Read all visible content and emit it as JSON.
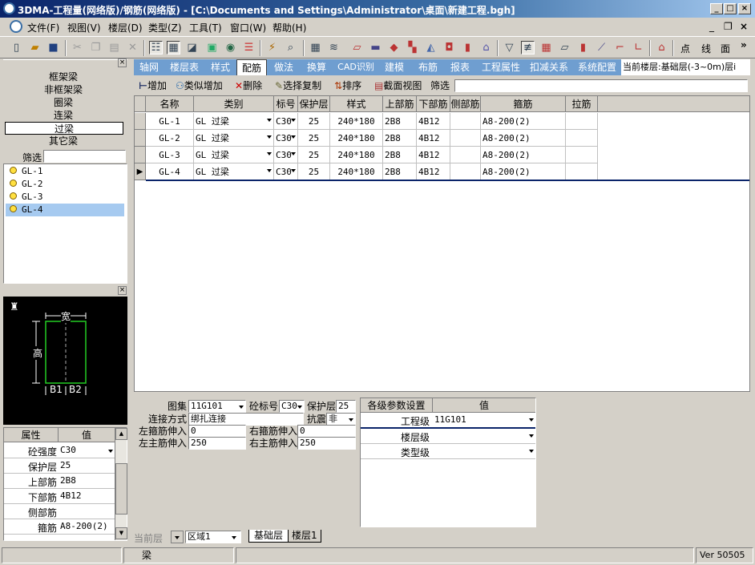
{
  "window": {
    "title": "3DMA-工程量(网络版)/钢筋(网络版) - [C:\\Documents and Settings\\Administrator\\桌面\\新建工程.bgh]",
    "min": "_",
    "restore": "□",
    "close": "×",
    "mdi_min": "_",
    "mdi_restore": "❐",
    "mdi_close": "×"
  },
  "menu": [
    "文件(F)",
    "视图(V)",
    "楼层(D)",
    "类型(Z)",
    "工具(T)",
    "窗口(W)",
    "帮助(H)"
  ],
  "toolbar": {
    "text_buttons": [
      "点",
      "线",
      "面"
    ],
    "more": "»"
  },
  "left": {
    "categories": [
      "框架梁",
      "非框架梁",
      "圈梁",
      "连梁",
      "过梁",
      "其它梁"
    ],
    "selected_category": "过梁",
    "filter_label": "筛选",
    "filter_value": "",
    "items": [
      "GL-1",
      "GL-2",
      "GL-3",
      "GL-4"
    ],
    "selected_item": "GL-4",
    "close": "×"
  },
  "diagram": {
    "width_label": "宽",
    "height_label": "高",
    "b1": "B1",
    "b2": "B2"
  },
  "properties": {
    "header_attr": "属性",
    "header_val": "值",
    "rows": [
      {
        "name": "砼强度",
        "value": "C30"
      },
      {
        "name": "保护层",
        "value": "25"
      },
      {
        "name": "上部筋",
        "value": "2B8"
      },
      {
        "name": "下部筋",
        "value": "4B12"
      },
      {
        "name": "侧部筋",
        "value": ""
      },
      {
        "name": "箍筋",
        "value": "A8-200(2)"
      }
    ]
  },
  "tabs": [
    "轴网",
    "楼层表",
    "样式",
    "配筋",
    "做法",
    "换算",
    "CAD识别",
    "建模",
    "布筋",
    "报表",
    "工程属性",
    "扣减关系",
    "系统配置"
  ],
  "active_tab": "配筋",
  "current_floor": "当前楼层:基础层(-3~0m)层i",
  "actions": {
    "add": "增加",
    "similar_add": "类似增加",
    "delete": "删除",
    "select_copy": "选择复制",
    "sort": "排序",
    "section_view": "截面视图",
    "filter": "筛选",
    "filter_value": ""
  },
  "grid": {
    "headers": [
      "名称",
      "类别",
      "标号",
      "保护层",
      "样式",
      "上部筋",
      "下部筋",
      "侧部筋",
      "箍筋",
      "拉筋"
    ],
    "rows": [
      {
        "name": "GL-1",
        "type": "GL  过梁",
        "grade": "C30",
        "cover": "25",
        "style": "240*180",
        "top": "2B8",
        "bottom": "4B12",
        "side": "",
        "stirrup": "A8-200(2)",
        "tie": ""
      },
      {
        "name": "GL-2",
        "type": "GL  过梁",
        "grade": "C30",
        "cover": "25",
        "style": "240*180",
        "top": "2B8",
        "bottom": "4B12",
        "side": "",
        "stirrup": "A8-200(2)",
        "tie": ""
      },
      {
        "name": "GL-3",
        "type": "GL  过梁",
        "grade": "C30",
        "cover": "25",
        "style": "240*180",
        "top": "2B8",
        "bottom": "4B12",
        "side": "",
        "stirrup": "A8-200(2)",
        "tie": ""
      },
      {
        "name": "GL-4",
        "type": "GL  过梁",
        "grade": "C30",
        "cover": "25",
        "style": "240*180",
        "top": "2B8",
        "bottom": "4B12",
        "side": "",
        "stirrup": "A8-200(2)",
        "tie": ""
      }
    ]
  },
  "params": {
    "atlas_label": "图集",
    "atlas_value": "11G101",
    "grade_label": "砼标号",
    "grade_value": "C30",
    "cover_label": "保护层",
    "cover_value": "25",
    "conn_label": "连接方式",
    "conn_value": "绑扎连接",
    "seismic_label": "抗震",
    "seismic_value": "非",
    "left_stir_label": "左箍筋伸入",
    "left_stir_value": "0",
    "right_stir_label": "右箍筋伸入",
    "right_stir_value": "0",
    "left_main_label": "左主筋伸入",
    "left_main_value": "250",
    "right_main_label": "右主筋伸入",
    "right_main_value": "250"
  },
  "levels": {
    "header_name": "各级参数设置",
    "header_val": "值",
    "rows": [
      {
        "name": "工程级",
        "value": "11G101"
      },
      {
        "name": "楼层级",
        "value": ""
      },
      {
        "name": "类型级",
        "value": ""
      }
    ]
  },
  "bottom": {
    "current_floor_label": "当前层",
    "region": "区域1",
    "sheet_tabs": [
      "基础层",
      "楼层1"
    ]
  },
  "status": {
    "field1": "",
    "field2": "梁",
    "field3": "",
    "version": "Ver 50505"
  }
}
